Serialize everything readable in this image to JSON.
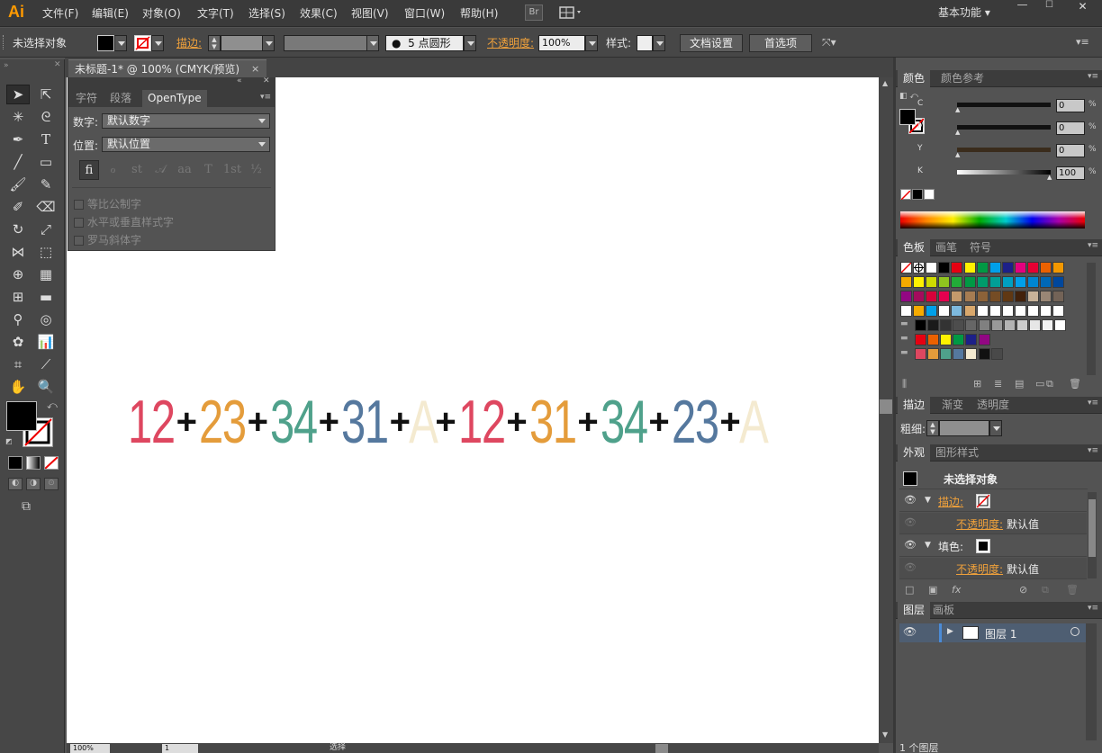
{
  "app": {
    "logo": "Ai",
    "workspace": "基本功能"
  },
  "menu": [
    "文件(F)",
    "编辑(E)",
    "对象(O)",
    "文字(T)",
    "选择(S)",
    "效果(C)",
    "视图(V)",
    "窗口(W)",
    "帮助(H)"
  ],
  "menu_badge": "Br",
  "control": {
    "selection": "未选择对象",
    "stroke_label": "描边:",
    "brush_size": "5",
    "brush_shape": "点圆形",
    "opacity_label": "不透明度:",
    "opacity_value": "100%",
    "style_label": "样式:",
    "doc_setup": "文档设置",
    "prefs": "首选项"
  },
  "document": {
    "tab_title": "未标题-1* @ 100% (CMYK/预览)",
    "close": "×"
  },
  "artwork": {
    "tokens": [
      {
        "t": "12",
        "c": "#de4760"
      },
      {
        "t": "+",
        "c": "#111111"
      },
      {
        "t": "23",
        "c": "#e49c3b"
      },
      {
        "t": "+",
        "c": "#111111"
      },
      {
        "t": "34",
        "c": "#4fa18b"
      },
      {
        "t": "+",
        "c": "#111111"
      },
      {
        "t": "31",
        "c": "#55789e"
      },
      {
        "t": "+",
        "c": "#111111"
      },
      {
        "t": "A",
        "c": "#f4ead0"
      },
      {
        "t": "+",
        "c": "#111111"
      },
      {
        "t": "12",
        "c": "#de4760"
      },
      {
        "t": "+",
        "c": "#111111"
      },
      {
        "t": "31",
        "c": "#e49c3b"
      },
      {
        "t": "+",
        "c": "#111111"
      },
      {
        "t": "34",
        "c": "#4fa18b"
      },
      {
        "t": "+",
        "c": "#111111"
      },
      {
        "t": "23",
        "c": "#55789e"
      },
      {
        "t": "+",
        "c": "#111111"
      },
      {
        "t": "A",
        "c": "#f4ead0"
      }
    ]
  },
  "opentype": {
    "tabs": [
      "字符",
      "段落",
      "OpenType"
    ],
    "number_label": "数字:",
    "number_value": "默认数字",
    "position_label": "位置:",
    "position_value": "默认位置",
    "glyphs": [
      "fi",
      "ℴ",
      "st",
      "𝒜",
      "aa",
      "T",
      "1st",
      "½"
    ],
    "checks": [
      "等比公制字",
      "水平或垂直样式字",
      "罗马斜体字"
    ]
  },
  "color": {
    "tabs": [
      "颜色",
      "颜色参考"
    ],
    "channels": [
      {
        "k": "C",
        "v": "0"
      },
      {
        "k": "M",
        "v": "0"
      },
      {
        "k": "Y",
        "v": "0"
      },
      {
        "k": "K",
        "v": "100"
      }
    ],
    "pct": "%"
  },
  "swatches": {
    "tabs": [
      "色板",
      "画笔",
      "符号"
    ],
    "rows": [
      [
        "#ffffff",
        "#ffffff",
        "#ffffff",
        "#000000",
        "#e60012",
        "#fff100",
        "#009944",
        "#00a0e9",
        "#1d2088",
        "#e4007f",
        "#e60033",
        "#eb6100",
        "#f39800"
      ],
      [
        "#f6ab00",
        "#fff100",
        "#cfdb00",
        "#8fc31f",
        "#22ac38",
        "#009944",
        "#009b6b",
        "#009e96",
        "#00a0c1",
        "#00a0e9",
        "#0086d1",
        "#0068b7",
        "#00479d"
      ],
      [
        "#920783",
        "#a40b5d",
        "#d7003a",
        "#e5004f",
        "#c49a6c",
        "#a67c52",
        "#8c6239",
        "#754c24",
        "#603813",
        "#42210b",
        "#c7b299",
        "#998675",
        "#736357"
      ],
      [
        "#ffffff",
        "#f6ab00",
        "#00a0e9",
        "#ffffff",
        "#7db9de",
        "#d9a86c",
        "#ffffff",
        "#ffffff",
        "#ffffff",
        "#ffffff",
        "#ffffff",
        "#ffffff",
        "#ffffff"
      ],
      [
        "#000000",
        "#1a1a1a",
        "#333333",
        "#4d4d4d",
        "#666666",
        "#808080",
        "#999999",
        "#b3b3b3",
        "#cccccc",
        "#e6e6e6",
        "#f2f2f2",
        "#ffffff"
      ],
      [
        "#e60012",
        "#eb6100",
        "#fff100",
        "#009944",
        "#1d2088",
        "#920783"
      ],
      [
        "#de4760",
        "#e49c3b",
        "#4fa18b",
        "#55789e",
        "#f4ead0",
        "#111111",
        "#494949"
      ]
    ]
  },
  "stroke": {
    "tabs": [
      "描边",
      "渐变",
      "透明度"
    ],
    "weight_label": "粗细:"
  },
  "appearance": {
    "tabs": [
      "外观",
      "图形样式"
    ],
    "header": "未选择对象",
    "rows": [
      {
        "label": "描边:",
        "kind": "stroke"
      },
      {
        "label": "不透明度:",
        "value": "默认值",
        "kind": "sub"
      },
      {
        "label": "填色:",
        "kind": "fill"
      },
      {
        "label": "不透明度:",
        "value": "默认值",
        "kind": "sub"
      }
    ]
  },
  "layers": {
    "tabs": [
      "图层",
      "画板"
    ],
    "layer_name": "图层 1",
    "footer": "1 个图层"
  },
  "status": {
    "zoom": "100%",
    "page": "1",
    "mode": "选择"
  }
}
